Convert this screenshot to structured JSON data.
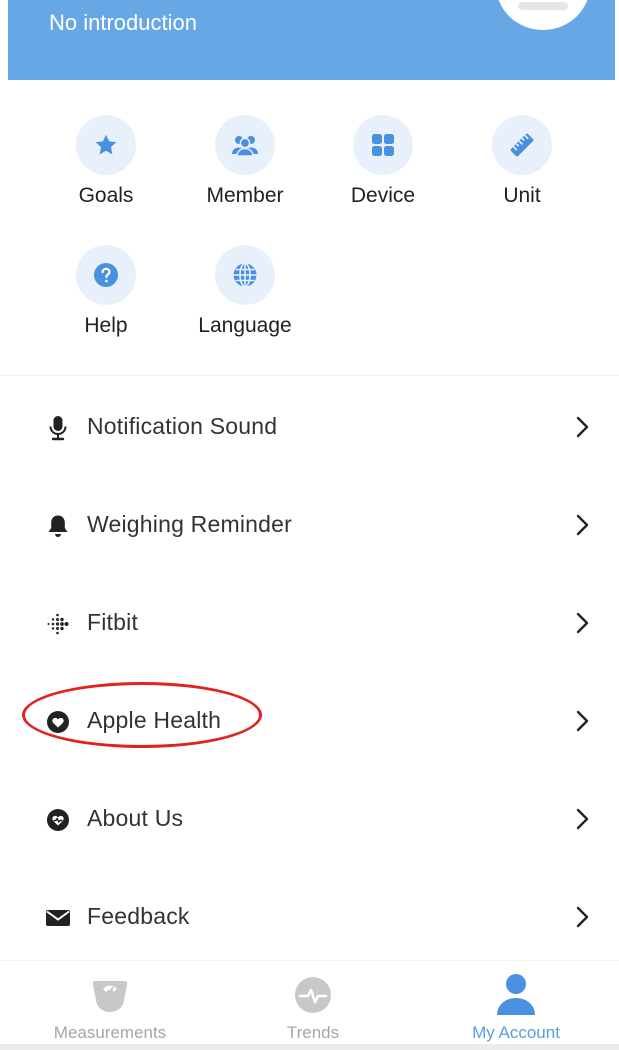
{
  "header": {
    "intro": "No introduction"
  },
  "grid": {
    "items": [
      {
        "label": "Goals",
        "icon": "star-icon"
      },
      {
        "label": "Member",
        "icon": "members-icon"
      },
      {
        "label": "Device",
        "icon": "grid-icon"
      },
      {
        "label": "Unit",
        "icon": "ruler-icon"
      },
      {
        "label": "Help",
        "icon": "question-icon"
      },
      {
        "label": "Language",
        "icon": "globe-icon"
      }
    ]
  },
  "list": {
    "items": [
      {
        "label": "Notification Sound",
        "icon": "microphone-icon"
      },
      {
        "label": "Weighing Reminder",
        "icon": "bell-icon"
      },
      {
        "label": "Fitbit",
        "icon": "fitbit-icon"
      },
      {
        "label": "Apple Health",
        "icon": "heart-circle-icon"
      },
      {
        "label": "About Us",
        "icon": "heart-badge-icon"
      },
      {
        "label": "Feedback",
        "icon": "envelope-icon"
      }
    ]
  },
  "tabbar": {
    "tabs": [
      {
        "label": "Measurements",
        "icon": "scale-icon",
        "active": false
      },
      {
        "label": "Trends",
        "icon": "pulse-icon",
        "active": false
      },
      {
        "label": "My Account",
        "icon": "person-icon",
        "active": true
      }
    ]
  },
  "colors": {
    "header_bg": "#67a7e6",
    "accent": "#4a8fe0",
    "icon_circle_bg": "#e8f1fb",
    "highlight": "#e0231e",
    "tab_inactive": "#a6a6a6",
    "tab_active": "#5b9de4"
  }
}
